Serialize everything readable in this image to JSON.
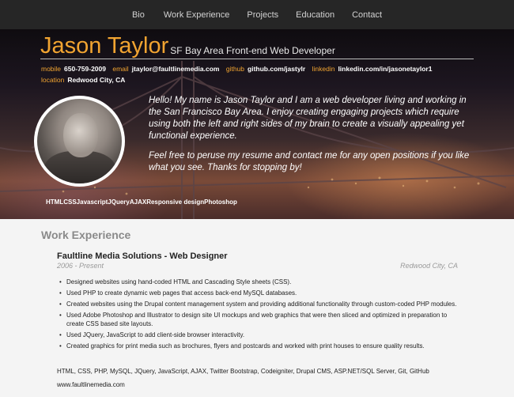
{
  "nav": {
    "items": [
      "Bio",
      "Work Experience",
      "Projects",
      "Education",
      "Contact"
    ]
  },
  "header": {
    "name": "Jason Taylor",
    "subtitle": "SF Bay Area Front-end Web Developer",
    "contact": {
      "mobile_label": "mobile",
      "mobile": "650-759-2009",
      "email_label": "email",
      "email": "jtaylor@faultlinemedia.com",
      "github_label": "github",
      "github": "github.com/jastylr",
      "linkedin_label": "linkedin",
      "linkedin": "linkedin.com/in/jasonetaylor1",
      "location_label": "location",
      "location": "Redwood City, CA"
    },
    "intro_p1": "Hello! My name is Jason Taylor and I am a web developer living and working in the San Francisco Bay Area. I enjoy creating engaging projects which require using both the left and right sides of my brain to create a visually appealing yet functional experience.",
    "intro_p2": "Feel free to peruse my resume and contact me for any open positions if you like what you see. Thanks for stopping by!",
    "skills": [
      "HTML",
      "CSS",
      "Javascript",
      "JQuery",
      "AJAX",
      "Responsive design",
      "Photoshop"
    ]
  },
  "work": {
    "section_title": "Work Experience",
    "job": {
      "title": "Faultline Media Solutions - Web Designer",
      "dates": "2006 - Present",
      "location": "Redwood City, CA",
      "duties": [
        "Designed websites using hand-coded HTML and Cascading Style sheets (CSS).",
        "Used PHP to create dynamic web pages that access back-end MySQL databases.",
        "Created websites using the Drupal content management system and providing additional functionality through custom-coded PHP modules.",
        "Used Adobe Photoshop and Illustrator to design site UI mockups and web graphics that were then sliced and optimized in preparation to create CSS based site layouts.",
        "Used JQuery, JavaScript to add client-side browser interactivity.",
        "Created graphics for print media such as brochures, flyers and postcards and worked with print houses to ensure quality results."
      ],
      "technologies": "HTML, CSS, PHP, MySQL, JQuery, JavaScript, AJAX, Twitter Bootstrap, Codeigniter, Drupal CMS, ASP.NET/SQL Server, Git, GitHub",
      "website": "www.faultlinemedia.com"
    }
  }
}
